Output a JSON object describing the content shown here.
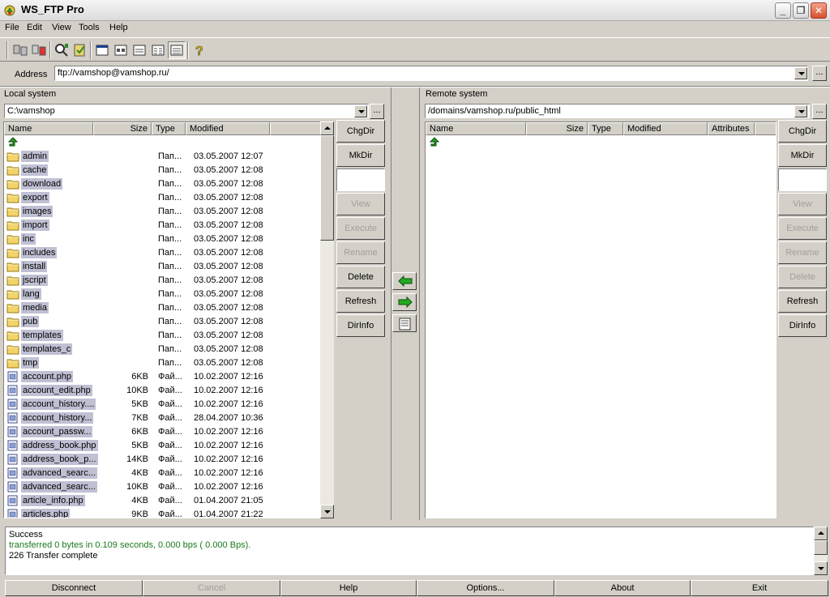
{
  "window": {
    "title": "WS_FTP Pro"
  },
  "menu": [
    "File",
    "Edit",
    "View",
    "Tools",
    "Help"
  ],
  "address": {
    "label": "Address",
    "value": "ftp://vamshop@vamshop.ru/",
    "browse": "..."
  },
  "local": {
    "label": "Local system",
    "path": "C:\\vamshop",
    "browse": "...",
    "columns": [
      "Name",
      "Size",
      "Type",
      "Modified"
    ],
    "files": [
      {
        "name": "admin",
        "size": "",
        "type": "Пап...",
        "modified": "03.05.2007 12:07",
        "kind": "folder"
      },
      {
        "name": "cache",
        "size": "",
        "type": "Пап...",
        "modified": "03.05.2007 12:08",
        "kind": "folder"
      },
      {
        "name": "download",
        "size": "",
        "type": "Пап...",
        "modified": "03.05.2007 12:08",
        "kind": "folder"
      },
      {
        "name": "export",
        "size": "",
        "type": "Пап...",
        "modified": "03.05.2007 12:08",
        "kind": "folder"
      },
      {
        "name": "images",
        "size": "",
        "type": "Пап...",
        "modified": "03.05.2007 12:08",
        "kind": "folder"
      },
      {
        "name": "import",
        "size": "",
        "type": "Пап...",
        "modified": "03.05.2007 12:08",
        "kind": "folder"
      },
      {
        "name": "inc",
        "size": "",
        "type": "Пап...",
        "modified": "03.05.2007 12:08",
        "kind": "folder"
      },
      {
        "name": "includes",
        "size": "",
        "type": "Пап...",
        "modified": "03.05.2007 12:08",
        "kind": "folder"
      },
      {
        "name": "install",
        "size": "",
        "type": "Пап...",
        "modified": "03.05.2007 12:08",
        "kind": "folder"
      },
      {
        "name": "jscript",
        "size": "",
        "type": "Пап...",
        "modified": "03.05.2007 12:08",
        "kind": "folder"
      },
      {
        "name": "lang",
        "size": "",
        "type": "Пап...",
        "modified": "03.05.2007 12:08",
        "kind": "folder"
      },
      {
        "name": "media",
        "size": "",
        "type": "Пап...",
        "modified": "03.05.2007 12:08",
        "kind": "folder"
      },
      {
        "name": "pub",
        "size": "",
        "type": "Пап...",
        "modified": "03.05.2007 12:08",
        "kind": "folder"
      },
      {
        "name": "templates",
        "size": "",
        "type": "Пап...",
        "modified": "03.05.2007 12:08",
        "kind": "folder"
      },
      {
        "name": "templates_c",
        "size": "",
        "type": "Пап...",
        "modified": "03.05.2007 12:08",
        "kind": "folder"
      },
      {
        "name": "tmp",
        "size": "",
        "type": "Пап...",
        "modified": "03.05.2007 12:08",
        "kind": "folder"
      },
      {
        "name": "account.php",
        "size": "6KB",
        "type": "Фай...",
        "modified": "10.02.2007 12:16",
        "kind": "file"
      },
      {
        "name": "account_edit.php",
        "size": "10KB",
        "type": "Фай...",
        "modified": "10.02.2007 12:16",
        "kind": "file"
      },
      {
        "name": "account_history....",
        "size": "5KB",
        "type": "Фай...",
        "modified": "10.02.2007 12:16",
        "kind": "file"
      },
      {
        "name": "account_history...",
        "size": "7KB",
        "type": "Фай...",
        "modified": "28.04.2007 10:36",
        "kind": "file"
      },
      {
        "name": "account_passw...",
        "size": "6KB",
        "type": "Фай...",
        "modified": "10.02.2007 12:16",
        "kind": "file"
      },
      {
        "name": "address_book.php",
        "size": "5KB",
        "type": "Фай...",
        "modified": "10.02.2007 12:16",
        "kind": "file"
      },
      {
        "name": "address_book_p...",
        "size": "14KB",
        "type": "Фай...",
        "modified": "10.02.2007 12:16",
        "kind": "file"
      },
      {
        "name": "advanced_searc...",
        "size": "4KB",
        "type": "Фай...",
        "modified": "10.02.2007 12:16",
        "kind": "file"
      },
      {
        "name": "advanced_searc...",
        "size": "10KB",
        "type": "Фай...",
        "modified": "10.02.2007 12:16",
        "kind": "file"
      },
      {
        "name": "article_info.php",
        "size": "4KB",
        "type": "Фай...",
        "modified": "01.04.2007 21:05",
        "kind": "file"
      },
      {
        "name": "articles.php",
        "size": "9KB",
        "type": "Фай...",
        "modified": "01.04.2007 21:22",
        "kind": "file"
      }
    ],
    "buttons": [
      "ChgDir",
      "MkDir",
      "View",
      "Execute",
      "Rename",
      "Delete",
      "Refresh",
      "DirInfo"
    ]
  },
  "remote": {
    "label": "Remote system",
    "path": "/domains/vamshop.ru/public_html",
    "browse": "...",
    "columns": [
      "Name",
      "Size",
      "Type",
      "Modified",
      "Attributes"
    ],
    "buttons": [
      "ChgDir",
      "MkDir",
      "View",
      "Execute",
      "Rename",
      "Delete",
      "Refresh",
      "DirInfo"
    ]
  },
  "log": {
    "lines": [
      "Success",
      "transferred 0 bytes in 0.109 seconds, 0.000 bps ( 0.000 Bps).",
      "226 Transfer complete"
    ]
  },
  "bottom": [
    "Disconnect",
    "Cancel",
    "Help",
    "Options...",
    "About",
    "Exit"
  ],
  "colors": {
    "selection": "#c0c0d4",
    "face": "#d4d0c8",
    "log_green": "#1a7a1a"
  }
}
